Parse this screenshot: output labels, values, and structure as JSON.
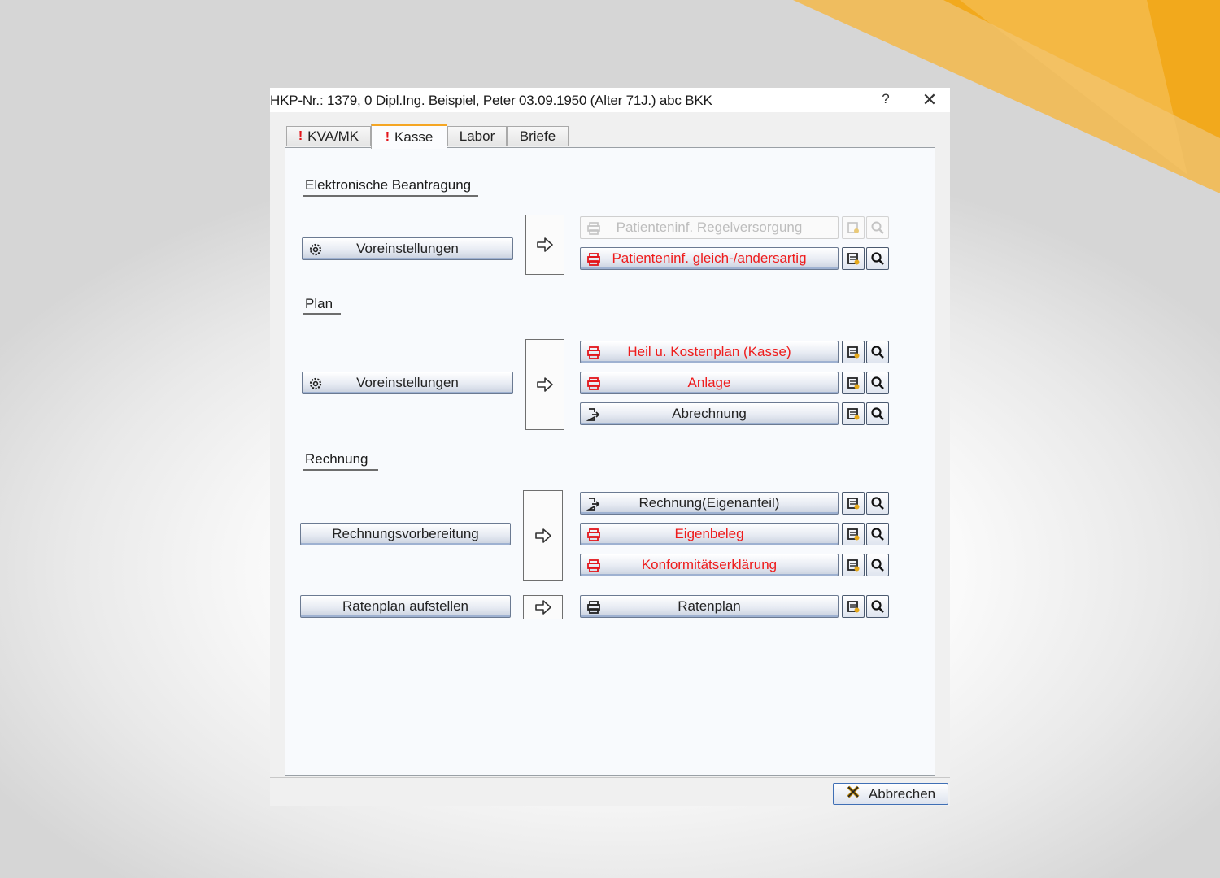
{
  "window": {
    "title": "HKP-Nr.: 1379, 0  Dipl.Ing. Beispiel, Peter  03.09.1950 (Alter 71J.)  abc BKK",
    "help_label": "?",
    "close_label": "✕"
  },
  "tabs": [
    {
      "label": "KVA/MK",
      "alert": "!"
    },
    {
      "label": "Kasse",
      "alert": "!"
    },
    {
      "label": "Labor",
      "alert": ""
    },
    {
      "label": "Briefe",
      "alert": ""
    }
  ],
  "active_tab": "Kasse",
  "sections": {
    "elektronisch": {
      "heading": "Elektronische Beantragung",
      "settings_button": "Voreinstellungen",
      "outputs": [
        {
          "label": "Patienteninf. Regelversorgung",
          "state": "disabled"
        },
        {
          "label": "Patienteninf. gleich-/andersartig",
          "state": "required"
        }
      ]
    },
    "plan": {
      "heading": "Plan",
      "settings_button": "Voreinstellungen",
      "outputs": [
        {
          "label": "Heil u. Kostenplan (Kasse)",
          "state": "required"
        },
        {
          "label": "Anlage",
          "state": "required"
        },
        {
          "label": "Abrechnung",
          "state": "normal"
        }
      ]
    },
    "rechnung": {
      "heading": "Rechnung",
      "prepare_button": "Rechnungsvorbereitung",
      "outputs": [
        {
          "label": "Rechnung(Eigenanteil)",
          "state": "normal"
        },
        {
          "label": "Eigenbeleg",
          "state": "required"
        },
        {
          "label": "Konformitätserklärung",
          "state": "required"
        }
      ],
      "installment_button": "Ratenplan aufstellen",
      "installment_output": {
        "label": "Ratenplan",
        "state": "normal"
      }
    }
  },
  "footer": {
    "cancel_label": "Abbrechen"
  },
  "colors": {
    "accent": "#f5a623",
    "required_text": "#ee1c1c",
    "button_border": "#6b7a92"
  },
  "icons": [
    "gear-icon",
    "printer-icon",
    "export-icon",
    "print-preview-icon",
    "magnifier-icon",
    "right-arrow-icon",
    "cancel-x-icon"
  ]
}
